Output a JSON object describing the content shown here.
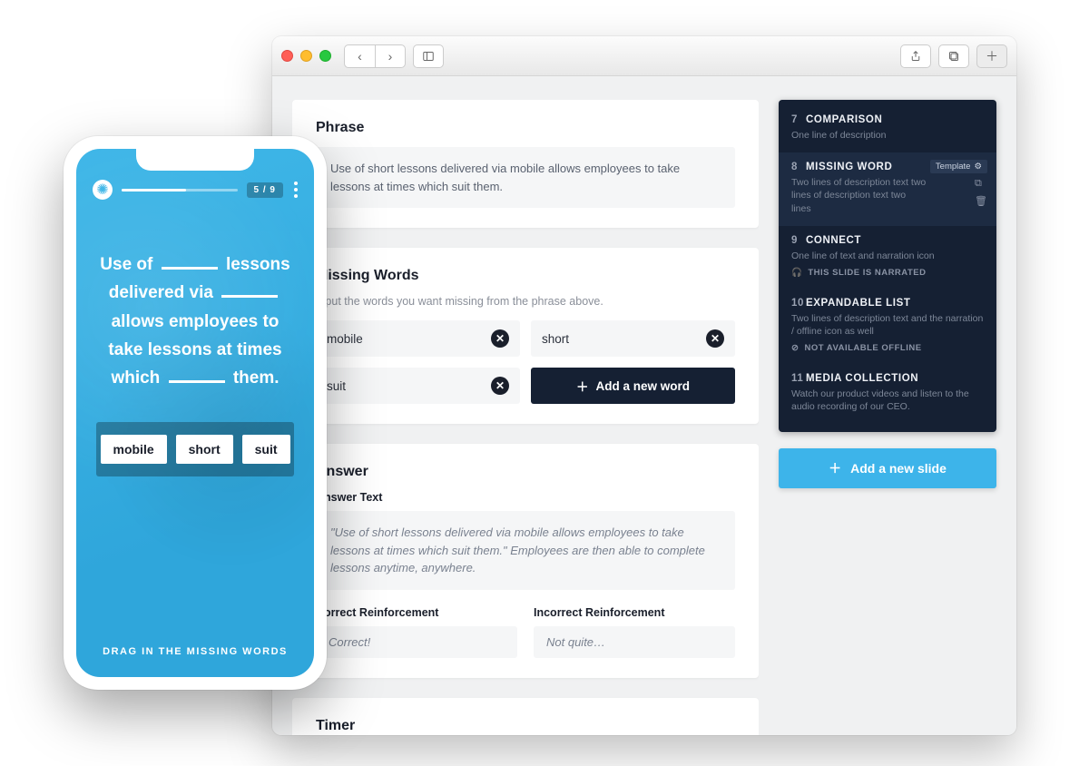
{
  "browser": {
    "toolbar": {
      "back": "‹",
      "forward": "›",
      "sidebar": "▯▯",
      "share": "⇧",
      "tabs": "⧉",
      "newtab": "＋"
    }
  },
  "editor": {
    "phrase": {
      "title": "Phrase",
      "text": "Use of short lessons delivered via mobile allows employees to take lessons at times which suit them."
    },
    "missing": {
      "title": "Missing Words",
      "sub": "Input the words you want missing from the phrase above.",
      "words": [
        "mobile",
        "short",
        "suit"
      ],
      "add": "Add a new word"
    },
    "answer": {
      "title": "Answer",
      "text_label": "Answer Text",
      "text": "\"Use of short lessons delivered via mobile allows employees to take lessons at times which suit them.\" Employees are then able to complete lessons anytime, anywhere.",
      "correct_label": "Correct Reinforcement",
      "correct": "Correct!",
      "incorrect_label": "Incorrect Reinforcement",
      "incorrect": "Not quite…"
    },
    "timer": {
      "title": "Timer"
    }
  },
  "slides": {
    "items": [
      {
        "num": "7",
        "title": "COMPARISON",
        "desc": "One line of description"
      },
      {
        "num": "8",
        "title": "MISSING WORD",
        "desc": "Two lines of description text two lines of description text two lines",
        "template": "Template"
      },
      {
        "num": "9",
        "title": "CONNECT",
        "desc": "One line of text and narration icon",
        "narration": "THIS SLIDE IS NARRATED"
      },
      {
        "num": "10",
        "title": "EXPANDABLE LIST",
        "desc": "Two lines of description text and the narration / offline icon as well",
        "narration": "NOT AVAILABLE OFFLINE"
      },
      {
        "num": "11",
        "title": "MEDIA COLLECTION",
        "desc": "Watch our product videos and listen to the audio recording of our CEO."
      }
    ],
    "add": "Add a new slide"
  },
  "phone": {
    "counter": "5 / 9",
    "sentence": {
      "p1": "Use of",
      "p2": "lessons delivered via",
      "p3": "allows employees to take lessons at times which",
      "p4": "them."
    },
    "words": [
      "mobile",
      "short",
      "suit"
    ],
    "drag": "DRAG IN THE MISSING WORDS"
  }
}
